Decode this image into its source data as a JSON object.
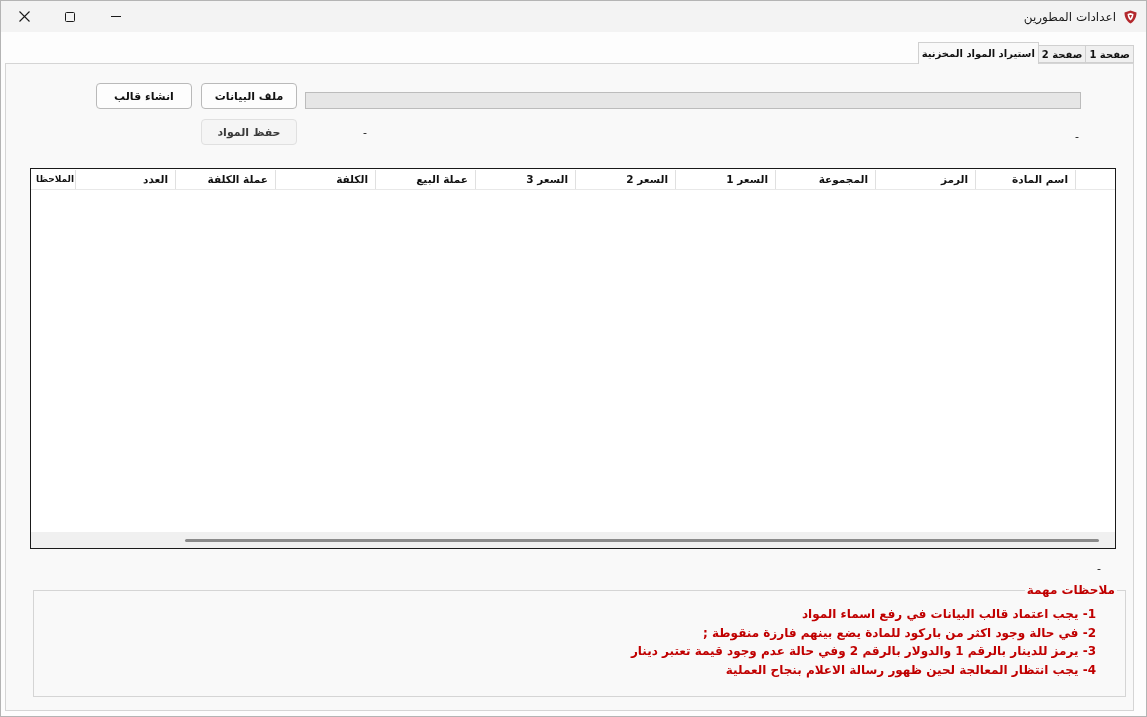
{
  "window": {
    "title": "اعدادات المطورين"
  },
  "tabs": [
    {
      "label": "صفحة 1",
      "selected": false
    },
    {
      "label": "صفحة 2",
      "selected": false
    },
    {
      "label": "استيراد المواد المخزنية",
      "selected": true
    }
  ],
  "import_panel": {
    "buttons": [
      {
        "label": "ملف البيانات",
        "disabled": false
      },
      {
        "label": "انشاء قالب",
        "disabled": false
      },
      {
        "label": "حفظ المواد",
        "disabled": true
      }
    ],
    "progress": {
      "level": 0
    },
    "status_labels": [
      "-",
      "-"
    ]
  },
  "table": {
    "columns": [
      "اسم المادة",
      "الرمز",
      "المجموعة",
      "السعر 1",
      "السعر 2",
      "السعر 3",
      "عملة البيع",
      "الكلفة",
      "عملة الكلفة",
      "العدد",
      "الملاحظا"
    ]
  },
  "footer_label": "-",
  "notes": {
    "title": "ملاحظات مهمة",
    "lines": [
      "1- يجب اعتماد قالب البيانات في رفع اسماء المواد",
      "2- في حالة وجود اكثر من باركود للمادة يضع بينهم فارزة منقوطة ;",
      "3- يرمز للدينار بالرقم 1 والدولار بالرقم 2 وفي حالة عدم وجود قيمة تعتبر دينار",
      "4- يجب انتظار المعالجة لحين ظهور رسالة الاعلام بنجاح العملية"
    ]
  }
}
